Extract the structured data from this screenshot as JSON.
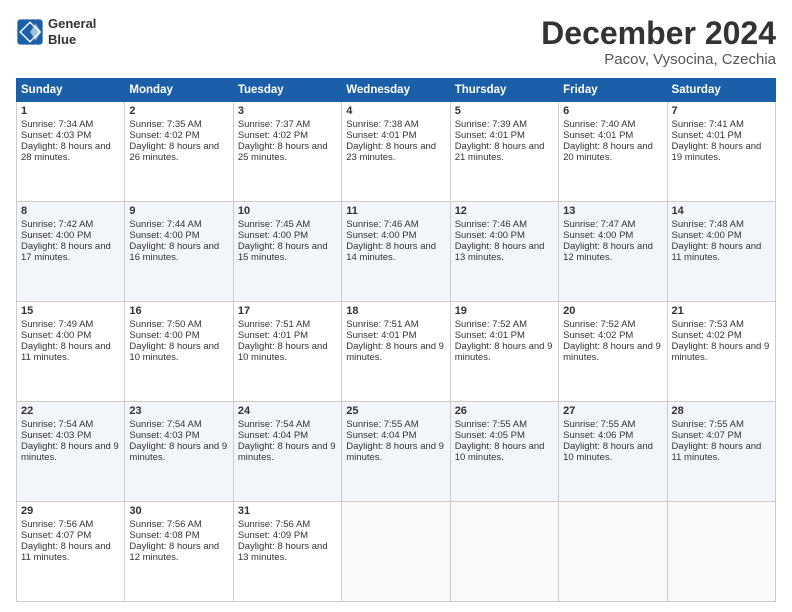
{
  "logo": {
    "line1": "General",
    "line2": "Blue"
  },
  "title": "December 2024",
  "subtitle": "Pacov, Vysocina, Czechia",
  "days_of_week": [
    "Sunday",
    "Monday",
    "Tuesday",
    "Wednesday",
    "Thursday",
    "Friday",
    "Saturday"
  ],
  "weeks": [
    [
      {
        "day": "1",
        "sunrise": "Sunrise: 7:34 AM",
        "sunset": "Sunset: 4:03 PM",
        "daylight": "Daylight: 8 hours and 28 minutes."
      },
      {
        "day": "2",
        "sunrise": "Sunrise: 7:35 AM",
        "sunset": "Sunset: 4:02 PM",
        "daylight": "Daylight: 8 hours and 26 minutes."
      },
      {
        "day": "3",
        "sunrise": "Sunrise: 7:37 AM",
        "sunset": "Sunset: 4:02 PM",
        "daylight": "Daylight: 8 hours and 25 minutes."
      },
      {
        "day": "4",
        "sunrise": "Sunrise: 7:38 AM",
        "sunset": "Sunset: 4:01 PM",
        "daylight": "Daylight: 8 hours and 23 minutes."
      },
      {
        "day": "5",
        "sunrise": "Sunrise: 7:39 AM",
        "sunset": "Sunset: 4:01 PM",
        "daylight": "Daylight: 8 hours and 21 minutes."
      },
      {
        "day": "6",
        "sunrise": "Sunrise: 7:40 AM",
        "sunset": "Sunset: 4:01 PM",
        "daylight": "Daylight: 8 hours and 20 minutes."
      },
      {
        "day": "7",
        "sunrise": "Sunrise: 7:41 AM",
        "sunset": "Sunset: 4:01 PM",
        "daylight": "Daylight: 8 hours and 19 minutes."
      }
    ],
    [
      {
        "day": "8",
        "sunrise": "Sunrise: 7:42 AM",
        "sunset": "Sunset: 4:00 PM",
        "daylight": "Daylight: 8 hours and 17 minutes."
      },
      {
        "day": "9",
        "sunrise": "Sunrise: 7:44 AM",
        "sunset": "Sunset: 4:00 PM",
        "daylight": "Daylight: 8 hours and 16 minutes."
      },
      {
        "day": "10",
        "sunrise": "Sunrise: 7:45 AM",
        "sunset": "Sunset: 4:00 PM",
        "daylight": "Daylight: 8 hours and 15 minutes."
      },
      {
        "day": "11",
        "sunrise": "Sunrise: 7:46 AM",
        "sunset": "Sunset: 4:00 PM",
        "daylight": "Daylight: 8 hours and 14 minutes."
      },
      {
        "day": "12",
        "sunrise": "Sunrise: 7:46 AM",
        "sunset": "Sunset: 4:00 PM",
        "daylight": "Daylight: 8 hours and 13 minutes."
      },
      {
        "day": "13",
        "sunrise": "Sunrise: 7:47 AM",
        "sunset": "Sunset: 4:00 PM",
        "daylight": "Daylight: 8 hours and 12 minutes."
      },
      {
        "day": "14",
        "sunrise": "Sunrise: 7:48 AM",
        "sunset": "Sunset: 4:00 PM",
        "daylight": "Daylight: 8 hours and 11 minutes."
      }
    ],
    [
      {
        "day": "15",
        "sunrise": "Sunrise: 7:49 AM",
        "sunset": "Sunset: 4:00 PM",
        "daylight": "Daylight: 8 hours and 11 minutes."
      },
      {
        "day": "16",
        "sunrise": "Sunrise: 7:50 AM",
        "sunset": "Sunset: 4:00 PM",
        "daylight": "Daylight: 8 hours and 10 minutes."
      },
      {
        "day": "17",
        "sunrise": "Sunrise: 7:51 AM",
        "sunset": "Sunset: 4:01 PM",
        "daylight": "Daylight: 8 hours and 10 minutes."
      },
      {
        "day": "18",
        "sunrise": "Sunrise: 7:51 AM",
        "sunset": "Sunset: 4:01 PM",
        "daylight": "Daylight: 8 hours and 9 minutes."
      },
      {
        "day": "19",
        "sunrise": "Sunrise: 7:52 AM",
        "sunset": "Sunset: 4:01 PM",
        "daylight": "Daylight: 8 hours and 9 minutes."
      },
      {
        "day": "20",
        "sunrise": "Sunrise: 7:52 AM",
        "sunset": "Sunset: 4:02 PM",
        "daylight": "Daylight: 8 hours and 9 minutes."
      },
      {
        "day": "21",
        "sunrise": "Sunrise: 7:53 AM",
        "sunset": "Sunset: 4:02 PM",
        "daylight": "Daylight: 8 hours and 9 minutes."
      }
    ],
    [
      {
        "day": "22",
        "sunrise": "Sunrise: 7:54 AM",
        "sunset": "Sunset: 4:03 PM",
        "daylight": "Daylight: 8 hours and 9 minutes."
      },
      {
        "day": "23",
        "sunrise": "Sunrise: 7:54 AM",
        "sunset": "Sunset: 4:03 PM",
        "daylight": "Daylight: 8 hours and 9 minutes."
      },
      {
        "day": "24",
        "sunrise": "Sunrise: 7:54 AM",
        "sunset": "Sunset: 4:04 PM",
        "daylight": "Daylight: 8 hours and 9 minutes."
      },
      {
        "day": "25",
        "sunrise": "Sunrise: 7:55 AM",
        "sunset": "Sunset: 4:04 PM",
        "daylight": "Daylight: 8 hours and 9 minutes."
      },
      {
        "day": "26",
        "sunrise": "Sunrise: 7:55 AM",
        "sunset": "Sunset: 4:05 PM",
        "daylight": "Daylight: 8 hours and 10 minutes."
      },
      {
        "day": "27",
        "sunrise": "Sunrise: 7:55 AM",
        "sunset": "Sunset: 4:06 PM",
        "daylight": "Daylight: 8 hours and 10 minutes."
      },
      {
        "day": "28",
        "sunrise": "Sunrise: 7:55 AM",
        "sunset": "Sunset: 4:07 PM",
        "daylight": "Daylight: 8 hours and 11 minutes."
      }
    ],
    [
      {
        "day": "29",
        "sunrise": "Sunrise: 7:56 AM",
        "sunset": "Sunset: 4:07 PM",
        "daylight": "Daylight: 8 hours and 11 minutes."
      },
      {
        "day": "30",
        "sunrise": "Sunrise: 7:56 AM",
        "sunset": "Sunset: 4:08 PM",
        "daylight": "Daylight: 8 hours and 12 minutes."
      },
      {
        "day": "31",
        "sunrise": "Sunrise: 7:56 AM",
        "sunset": "Sunset: 4:09 PM",
        "daylight": "Daylight: 8 hours and 13 minutes."
      },
      null,
      null,
      null,
      null
    ]
  ]
}
